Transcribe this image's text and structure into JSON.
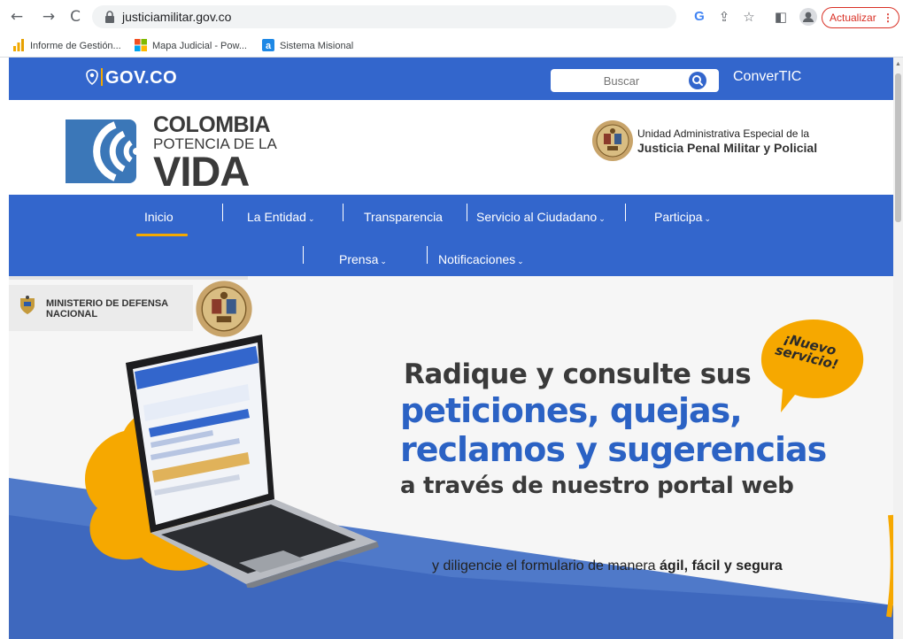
{
  "browser": {
    "url": "justiciamilitar.gov.co",
    "update_label": "Actualizar",
    "update_menu_glyph": "⋮",
    "nav_back": "←",
    "nav_forward": "→",
    "nav_reload": "C",
    "toolbar_google": "G",
    "toolbar_share": "⇪",
    "toolbar_star": "☆",
    "toolbar_sidepanel": "◧",
    "bookmarks": [
      {
        "label": "Informe de Gestión...",
        "icon": "bar-chart-icon"
      },
      {
        "label": "Mapa Judicial - Pow...",
        "icon": "microsoft-logo-icon"
      },
      {
        "label": "Sistema Misional",
        "icon": "app-logo-icon"
      }
    ]
  },
  "govbar": {
    "logo_text": "GOV.CO",
    "search_placeholder": "Buscar",
    "convertic_label": "ConverTIC"
  },
  "header": {
    "brand_line1": "COLOMBIA",
    "brand_line2": "POTENCIA DE LA",
    "brand_line3": "VIDA",
    "entity_line1": "Unidad Administrativa Especial de la",
    "entity_line2": "Justicia Penal Militar y Policial"
  },
  "nav": {
    "row1": [
      {
        "label": "Inicio",
        "active": true,
        "dropdown": false
      },
      {
        "label": "La Entidad",
        "dropdown": true
      },
      {
        "label": "Transparencia",
        "dropdown": false
      },
      {
        "label": "Servicio al Ciudadano",
        "dropdown": true
      },
      {
        "label": "Participa",
        "dropdown": true
      }
    ],
    "row2": [
      {
        "label": "Prensa",
        "dropdown": true
      },
      {
        "label": "Notificaciones",
        "dropdown": true
      }
    ],
    "caret": "⌄"
  },
  "hero": {
    "ministry_line1": "MINISTERIO DE DEFENSA",
    "ministry_line2": "NACIONAL",
    "line1": "Radique y consulte sus",
    "line2": "peticiones, quejas,",
    "line3": "reclamos y sugerencias",
    "line4": "a través de nuestro portal web",
    "sub_text": "y diligencie el formulario de manera ",
    "sub_bold": "ágil, fácil y segura",
    "badge_line1": "¡Nuevo",
    "badge_line2": "servicio!",
    "colors": {
      "blue": "#2b62c4",
      "orange": "#f6a800",
      "dark": "#3a3a3a"
    }
  }
}
